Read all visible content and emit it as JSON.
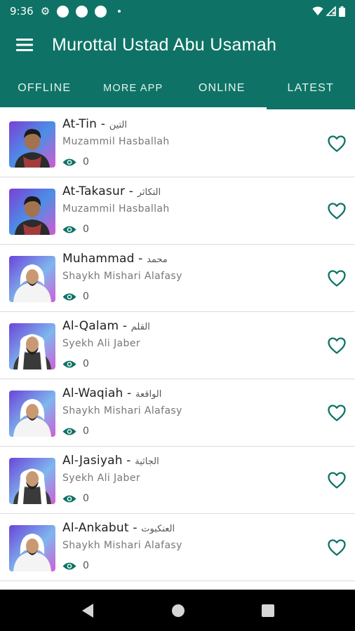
{
  "status_bar": {
    "time": "9:36"
  },
  "app_bar": {
    "title": "Murottal Ustad Abu Usamah"
  },
  "tabs": [
    {
      "label": "OFFLINE"
    },
    {
      "label": "MORE APP"
    },
    {
      "label": "ONLINE"
    },
    {
      "label": "LATEST"
    }
  ],
  "items": [
    {
      "title": "At-Tin",
      "arabic": "التين",
      "reciter": "Muzammil Hasballah",
      "views": "0",
      "avatar": "young-man-portrait"
    },
    {
      "title": "At-Takasur",
      "arabic": "التكاثر",
      "reciter": "Muzammil Hasballah",
      "views": "0",
      "avatar": "young-man-portrait"
    },
    {
      "title": "Muhammad",
      "arabic": "محمد",
      "reciter": "Shaykh Mishari Alafasy",
      "views": "0",
      "avatar": "man-white-headscarf-portrait"
    },
    {
      "title": "Al-Qalam",
      "arabic": "القلم",
      "reciter": "Syekh Ali Jaber",
      "views": "0",
      "avatar": "man-white-cap-portrait"
    },
    {
      "title": "Al-Waqiah",
      "arabic": "الواقعة",
      "reciter": "Shaykh Mishari Alafasy",
      "views": "0",
      "avatar": "man-white-headscarf-portrait"
    },
    {
      "title": "Al-Jasiyah",
      "arabic": "الجاثية",
      "reciter": "Syekh Ali Jaber",
      "views": "0",
      "avatar": "man-white-cap-portrait"
    },
    {
      "title": "Al-Ankabut",
      "arabic": "العنكبوت",
      "reciter": "Shaykh Mishari Alafasy",
      "views": "0",
      "avatar": "man-white-headscarf-portrait"
    }
  ],
  "colors": {
    "primary": "#0e7366",
    "accent": "#0e7366"
  }
}
